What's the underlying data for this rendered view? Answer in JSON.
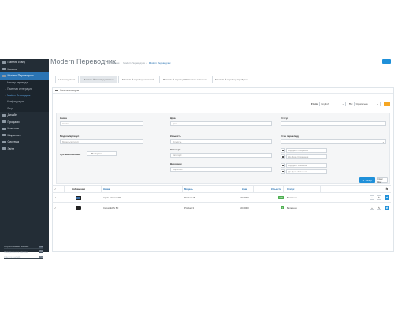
{
  "sidebar": {
    "items": [
      {
        "label": "Панель стану",
        "active": false
      },
      {
        "label": "Каталог",
        "active": false
      },
      {
        "label": "Modern Переводчик",
        "active": true
      }
    ],
    "subitems": [
      {
        "label": "Мастер перевода",
        "active": false
      },
      {
        "label": "Пакетная интеграция",
        "active": false
      },
      {
        "label": "Modern Переводчик",
        "active": true
      },
      {
        "label": "Конфигурация",
        "active": false
      },
      {
        "label": "Лицо",
        "active": false
      }
    ],
    "items2": [
      {
        "label": "Дизайн"
      },
      {
        "label": "Продажи"
      },
      {
        "label": "Клиенты"
      },
      {
        "label": "Маркетинг"
      },
      {
        "label": "Система"
      },
      {
        "label": "Звіти"
      }
    ],
    "stats": [
      {
        "label": "Обработанные заказы",
        "value": "0%"
      },
      {
        "label": "Завершённые заказы",
        "value": "0%"
      },
      {
        "label": "Клієнти онлайн",
        "value": "0%"
      }
    ]
  },
  "header": {
    "title": "Modern Переводчик",
    "breadcrumbs": [
      "Главная",
      "Modern Переводчик",
      "Modern Переводчик"
    ]
  },
  "tabs": [
    {
      "label": "Налаштування",
      "active": false
    },
    {
      "label": "Массовый перевод товаров",
      "active": true
    },
    {
      "label": "Массовый перевод категорий",
      "active": false
    },
    {
      "label": "Массовый перевод SEO-Ключ значения",
      "active": false
    },
    {
      "label": "Массовый перевод атрибутов",
      "active": false
    }
  ],
  "panel": {
    "title": "Список товаров",
    "from_label": "From:",
    "from_value": "English",
    "to_label": "To:",
    "to_value": "Українська"
  },
  "filters": {
    "name": {
      "label": "Назва",
      "placeholder": "Назва"
    },
    "price": {
      "label": "Ціна",
      "placeholder": "Ціна"
    },
    "status": {
      "label": "Статус",
      "value": ""
    },
    "model": {
      "label": "Модель/артикул",
      "placeholder": "Модель/артикул"
    },
    "qty": {
      "label": "Кількість",
      "placeholder": "Кількість"
    },
    "translate_status": {
      "label": "Стан перекладу",
      "value": ""
    },
    "empty_desc": {
      "label": "Пустые описания",
      "value": "--- Выберите ---"
    },
    "category": {
      "label": "Категорії",
      "placeholder": "Категорії"
    },
    "manufacturer": {
      "label": "Виробник",
      "placeholder": "Виробник"
    },
    "date_added_from": {
      "placeholder": "Від дати створення"
    },
    "date_added_to": {
      "placeholder": "До Дата Створення"
    },
    "date_mod_from": {
      "placeholder": "Від дати змінення"
    },
    "date_mod_to": {
      "placeholder": "До Дата Змінення"
    },
    "filter_button": "Фільтр",
    "clear_button": "Clear filter"
  },
  "table": {
    "columns": [
      "Зображення",
      "Назва",
      "Модель",
      "Ціна",
      "Кількість",
      "Статус"
    ],
    "rows": [
      {
        "name": "Apple Cinema 30\"",
        "model": "Product 15",
        "price": "100.0000",
        "qty": "990",
        "qty_color": "#4caf50",
        "status": "Включено"
      },
      {
        "name": "Canon EOS 5D",
        "model": "Product 3",
        "price": "100.0000",
        "qty": "7",
        "qty_color": "#4caf50",
        "status": "Включено"
      }
    ]
  },
  "colors": {
    "sidebar_bg": "#232d36",
    "accent": "#1f90d9",
    "orange": "#f5a623",
    "active_sidebar": "#2b74b3"
  }
}
